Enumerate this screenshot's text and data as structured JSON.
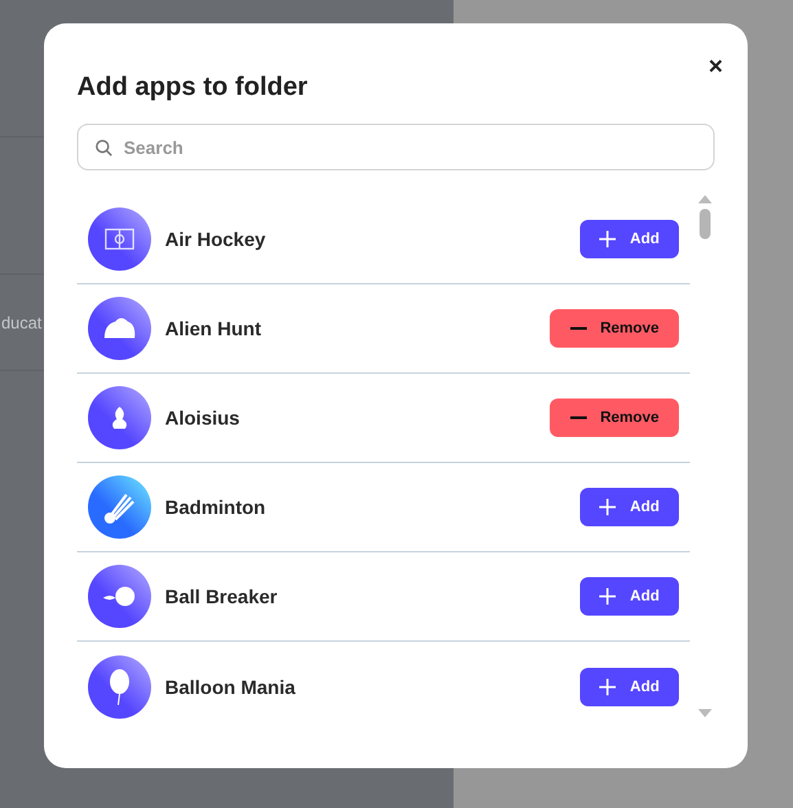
{
  "background": {
    "tab_label": "ducat"
  },
  "dialog": {
    "title": "Add apps to folder",
    "close": "×",
    "search": {
      "placeholder": "Search"
    },
    "apps": [
      {
        "name": "Air Hockey",
        "added": false,
        "action": "Add"
      },
      {
        "name": "Alien Hunt",
        "added": true,
        "action": "Remove"
      },
      {
        "name": "Aloisius",
        "added": true,
        "action": "Remove"
      },
      {
        "name": "Badminton",
        "added": false,
        "action": "Add"
      },
      {
        "name": "Ball Breaker",
        "added": false,
        "action": "Add"
      },
      {
        "name": "Balloon Mania",
        "added": false,
        "action": "Add"
      }
    ]
  }
}
